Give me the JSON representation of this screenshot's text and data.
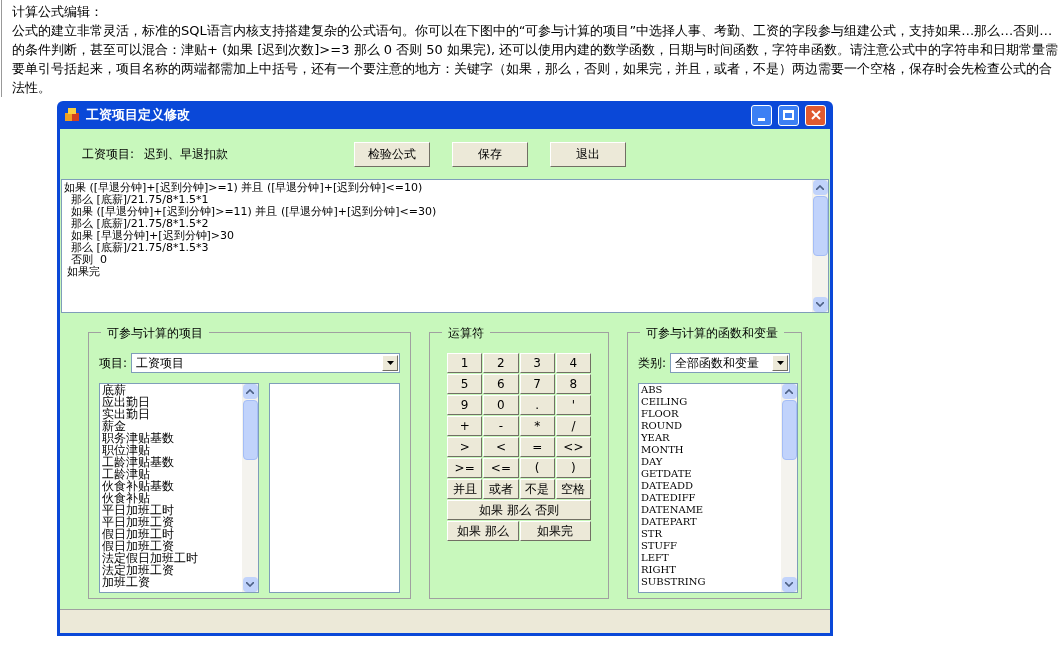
{
  "page": {
    "heading": "计算公式编辑：",
    "description": "公式的建立非常灵活，标准的SQL语言内核支持搭建复杂的公式语句。你可以在下图中的“可参与计算的项目”中选择人事、考勤、工资的字段参与组建公式，支持如果…那么…否则…的条件判断，甚至可以混合：津贴+ (如果  [迟到次数]>=3 那么  0 否则  50 如果完), 还可以使用内建的数学函数，日期与时间函数，字符串函数。请注意公式中的字符串和日期常量需要单引号括起来，项目名称的两端都需加上中括号，还有一个要注意的地方：关键字（如果，那么，否则，如果完，并且，或者，不是）两边需要一个空格，保存时会先检查公式的合法性。"
  },
  "window": {
    "title": "工资项目定义修改"
  },
  "header": {
    "label": "工资项目:",
    "value": "迟到、早退扣款",
    "buttons": [
      "检验公式",
      "保存",
      "退出"
    ]
  },
  "formula": [
    "如果 ([早退分钟]+[迟到分钟]>=1) 并且 ([早退分钟]+[迟到分钟]<=10)",
    "  那么 [底薪]/21.75/8*1.5*1",
    "  如果 ([早退分钟]+[迟到分钟]>=11) 并且 ([早退分钟]+[迟到分钟]<=30)",
    "  那么 [底薪]/21.75/8*1.5*2",
    "  如果 [早退分钟]+[迟到分钟]>30",
    "  那么 [底薪]/21.75/8*1.5*3",
    "  否则  0",
    " 如果完"
  ],
  "items_group": {
    "title": "可参与计算的项目",
    "label": "项目:",
    "value": "工资项目",
    "items": [
      "底薪",
      "应出勤日",
      "实出勤日",
      "薪金",
      "职务津贴基数",
      "职位津贴",
      "工龄津贴基数",
      "工龄津贴",
      "伙食补贴基数",
      "伙食补贴",
      "平日加班工时",
      "平日加班工资",
      "假日加班工时",
      "假日加班工资",
      "法定假日加班工时",
      "法定加班工资",
      "加班工资"
    ]
  },
  "operators_group": {
    "title": "运算符",
    "keys": [
      {
        "label": "1",
        "kind": "key"
      },
      {
        "label": "2",
        "kind": "key"
      },
      {
        "label": "3",
        "kind": "key"
      },
      {
        "label": "4",
        "kind": "key"
      },
      {
        "label": "5",
        "kind": "key"
      },
      {
        "label": "6",
        "kind": "key"
      },
      {
        "label": "7",
        "kind": "key"
      },
      {
        "label": "8",
        "kind": "key"
      },
      {
        "label": "9",
        "kind": "key"
      },
      {
        "label": "0",
        "kind": "key"
      },
      {
        "label": ".",
        "kind": "key"
      },
      {
        "label": "'",
        "kind": "key"
      },
      {
        "label": "+",
        "kind": "key"
      },
      {
        "label": "-",
        "kind": "key"
      },
      {
        "label": "*",
        "kind": "key"
      },
      {
        "label": "/",
        "kind": "key"
      },
      {
        "label": ">",
        "kind": "key"
      },
      {
        "label": "<",
        "kind": "key"
      },
      {
        "label": "=",
        "kind": "key"
      },
      {
        "label": "<>",
        "kind": "key"
      },
      {
        "label": ">=",
        "kind": "key"
      },
      {
        "label": "<=",
        "kind": "key"
      },
      {
        "label": "(",
        "kind": "key"
      },
      {
        "label": ")",
        "kind": "key"
      },
      {
        "label": "并且",
        "kind": "key"
      },
      {
        "label": "或者",
        "kind": "key"
      },
      {
        "label": "不是",
        "kind": "key"
      },
      {
        "label": "空格",
        "kind": "key"
      },
      {
        "label": "如果 那么 否则",
        "kind": "row"
      },
      {
        "label": "如果 那么",
        "kind": "pair"
      },
      {
        "label": "如果完",
        "kind": "pair"
      }
    ]
  },
  "functions_group": {
    "title": "可参与计算的函数和变量",
    "label": "类别:",
    "value": "全部函数和变量",
    "items": [
      "ABS",
      "CEILING",
      "FLOOR",
      "ROUND",
      "YEAR",
      "MONTH",
      "DAY",
      "GETDATE",
      "DATEADD",
      "DATEDIFF",
      "DATENAME",
      "DATEPART",
      "STR",
      "STUFF",
      "LEFT",
      "RIGHT",
      "SUBSTRING"
    ]
  }
}
